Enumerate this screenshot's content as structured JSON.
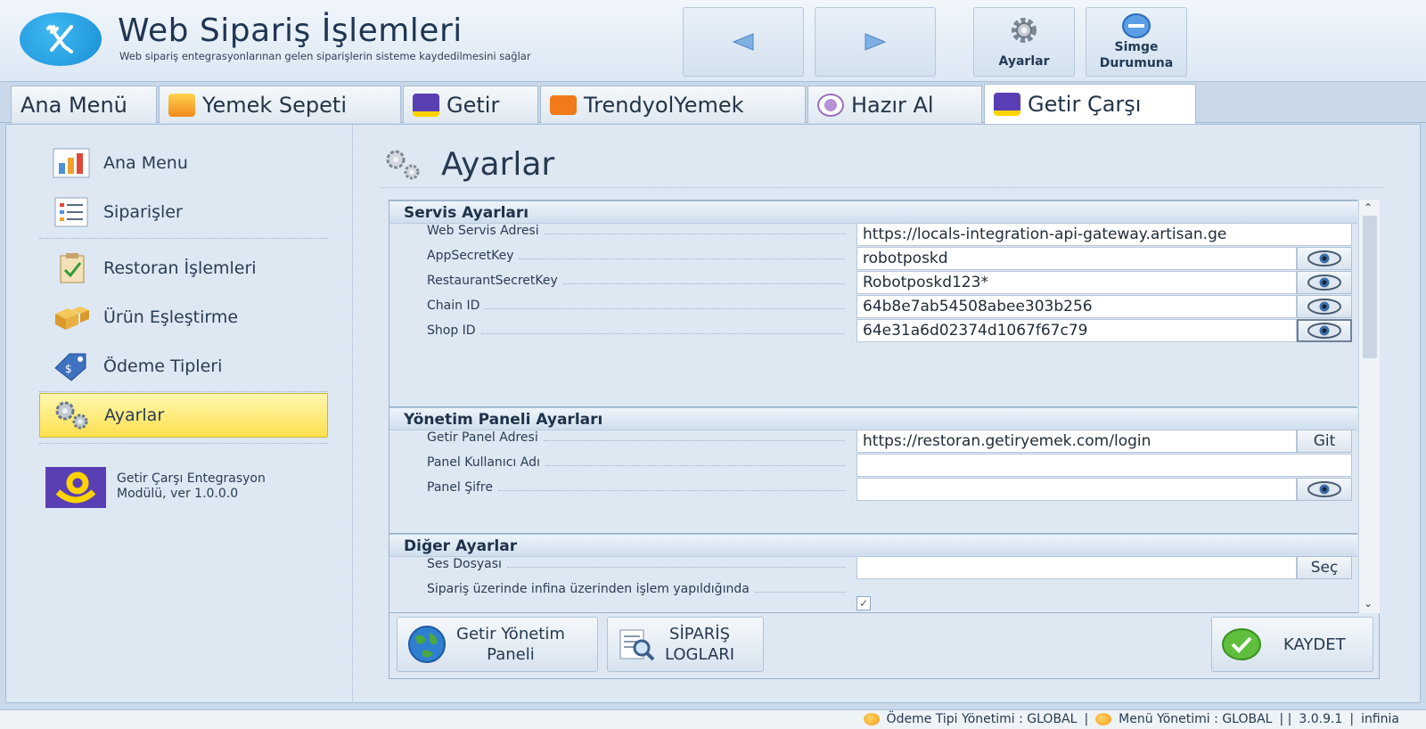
{
  "header": {
    "title": "Web Sipariş İşlemleri",
    "subtitle": "Web sipariş entegrasyonlarınan gelen siparişlerin sisteme kaydedilmesini sağlar",
    "settings_label": "Ayarlar",
    "minimize_label_1": "Simge",
    "minimize_label_2": "Durumuna"
  },
  "tabs": [
    {
      "label": "Ana Menü"
    },
    {
      "label": "Yemek Sepeti"
    },
    {
      "label": "Getir"
    },
    {
      "label": "TrendyolYemek"
    },
    {
      "label": "Hazır Al"
    },
    {
      "label": "Getir Çarşı"
    }
  ],
  "sidebar": {
    "items": [
      {
        "label": "Ana Menu"
      },
      {
        "label": "Siparişler"
      },
      {
        "label": "Restoran İşlemleri"
      },
      {
        "label": "Ürün Eşleştirme"
      },
      {
        "label": "Ödeme Tipleri"
      },
      {
        "label": "Ayarlar"
      }
    ],
    "module_line1": "Getir Çarşı Entegrasyon",
    "module_line2": "Modülü, ver 1.0.0.0"
  },
  "main": {
    "title": "Ayarlar",
    "service_section": {
      "title": "Servis Ayarları",
      "rows": [
        {
          "label": "Web Servis Adresi",
          "value": "https://locals-integration-api-gateway.artisan.ge"
        },
        {
          "label": "AppSecretKey",
          "value": "robotposkd"
        },
        {
          "label": "RestaurantSecretKey",
          "value": "Robotposkd123*"
        },
        {
          "label": "Chain ID",
          "value": "64b8e7ab54508abee303b256"
        },
        {
          "label": "Shop ID",
          "value": "64e31a6d02374d1067f67c79"
        }
      ]
    },
    "panel_section": {
      "title": "Yönetim Paneli Ayarları",
      "rows": [
        {
          "label": "Getir Panel Adresi",
          "value": "https://restoran.getiryemek.com/login",
          "button": "Git"
        },
        {
          "label": "Panel Kullanıcı Adı",
          "value": ""
        },
        {
          "label": "Panel Şifre",
          "value": ""
        }
      ]
    },
    "other_section": {
      "title": "Diğer Ayarlar",
      "rows": [
        {
          "label": "Ses Dosyası",
          "value": "",
          "button": "Seç"
        },
        {
          "label": "Sipariş üzerinde infina üzerinden işlem yapıldığında",
          "checked": true
        }
      ]
    },
    "buttons": {
      "panel_1": "Getir Yönetim",
      "panel_2": "Paneli",
      "logs_1": "SİPARİŞ",
      "logs_2": "LOGLARI",
      "save": "KAYDET"
    }
  },
  "status": {
    "payment": "Ödeme Tipi Yönetimi : GLOBAL",
    "menu": "Menü Yönetimi : GLOBAL",
    "version": "3.0.9.1",
    "user": "infinia"
  },
  "colors": {
    "accent": "#1a8fd6",
    "active_item": "#ffe04f",
    "getir_purple": "#5a3fb4",
    "getir_yellow": "#ffd300"
  }
}
